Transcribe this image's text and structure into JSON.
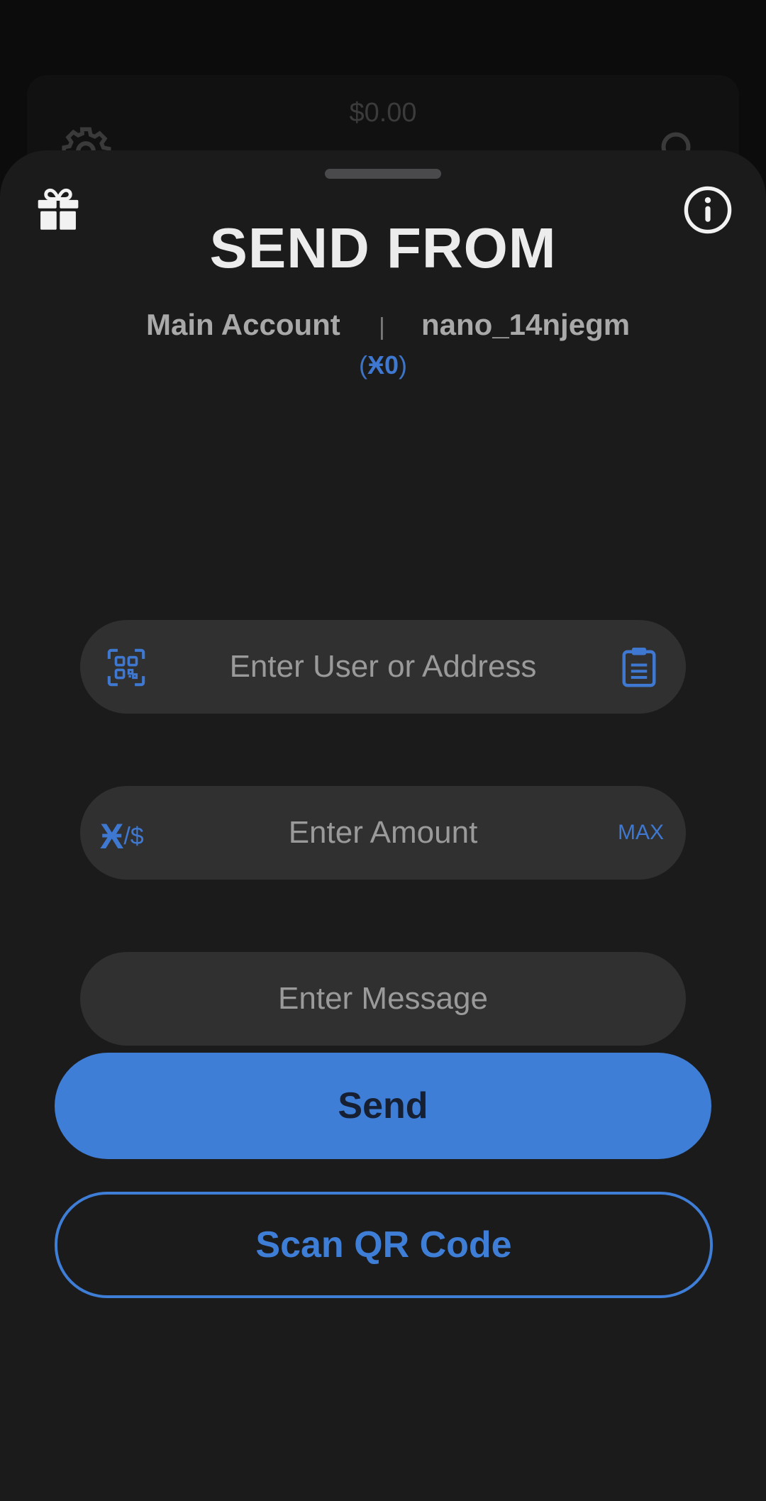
{
  "background": {
    "balance": "$0.00"
  },
  "sheet": {
    "title": "SEND FROM",
    "account_name": "Main Account",
    "separator": "|",
    "account_address": "nano_14njegm",
    "balance_open": "(",
    "balance_symbol": "Ӿ",
    "balance_value": "0",
    "balance_close": ")"
  },
  "form": {
    "address_placeholder": "Enter User or Address",
    "amount_placeholder": "Enter Amount",
    "currency_symbol": "Ӿ",
    "currency_toggle": "/$",
    "max_label": "MAX",
    "message_placeholder": "Enter Message"
  },
  "actions": {
    "send_label": "Send",
    "scan_label": "Scan QR Code"
  },
  "colors": {
    "accent": "#3e7ed6",
    "sheet_bg": "#1b1b1c",
    "field_bg": "#303031"
  },
  "icons": {
    "gift": "gift-icon",
    "info": "info-icon",
    "qr": "qr-scan-icon",
    "clipboard": "clipboard-icon",
    "settings": "gear-icon",
    "search": "search-icon"
  }
}
